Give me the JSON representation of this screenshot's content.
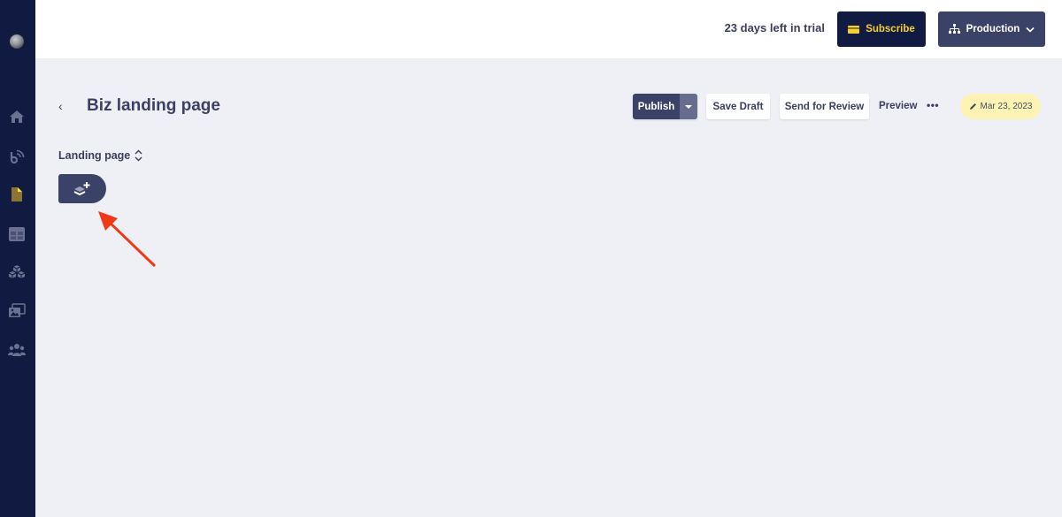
{
  "sidebar": {
    "avatar": "user-avatar",
    "items": [
      {
        "name": "home",
        "icon": "home-icon",
        "color": "#6b7191"
      },
      {
        "name": "broadcast",
        "icon": "broadcast-icon",
        "color": "#6b7191"
      },
      {
        "name": "pages",
        "icon": "page-icon",
        "color": "#8b7434",
        "accent": "#f5e430",
        "active": true
      },
      {
        "name": "layouts",
        "icon": "layout-grid-icon",
        "color": "#6b7191"
      },
      {
        "name": "components",
        "icon": "cubes-icon",
        "color": "#6b7191"
      },
      {
        "name": "media",
        "icon": "media-gallery-icon",
        "color": "#6b7191"
      },
      {
        "name": "users",
        "icon": "users-icon",
        "color": "#6b7191"
      }
    ]
  },
  "topbar": {
    "trial_text": "23 days left in trial",
    "subscribe_label": "Subscribe",
    "environment_label": "Production"
  },
  "page": {
    "back_label": "‹",
    "title": "Biz landing page",
    "actions": {
      "publish_label": "Publish",
      "save_draft_label": "Save Draft",
      "send_review_label": "Send for Review",
      "preview_label": "Preview",
      "more_label": "•••",
      "date_label": "Mar 23, 2023"
    },
    "section_label": "Landing page",
    "add_section_icon": "add-layer-icon"
  },
  "annotation": {
    "arrow_color": "#f03a17"
  },
  "colors": {
    "sidebar_bg": "#111a40",
    "accent_navy": "#3b4268",
    "subscribe_text": "#f5d130",
    "date_pill_bg": "#fdf3b4",
    "page_bg": "#eff0f6"
  }
}
